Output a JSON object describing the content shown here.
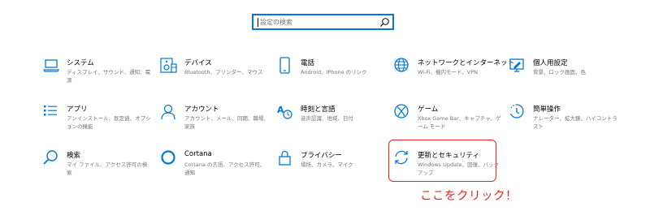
{
  "search": {
    "placeholder": "設定の検索"
  },
  "tiles": [
    {
      "title": "システム",
      "desc": "ディスプレイ、サウンド、通知、電源",
      "icon": "laptop-icon"
    },
    {
      "title": "デバイス",
      "desc": "Bluetooth、プリンター、マウス",
      "icon": "devices-icon"
    },
    {
      "title": "電話",
      "desc": "Android、iPhone のリンク",
      "icon": "phone-icon"
    },
    {
      "title": "ネットワークとインターネット",
      "desc": "Wi-Fi、機内モード、VPN",
      "icon": "globe-icon"
    },
    {
      "title": "個人用設定",
      "desc": "背景、ロック画面、色",
      "icon": "personalization-icon"
    },
    {
      "title": "アプリ",
      "desc": "アンインストール、既定値、オプションの機能",
      "icon": "apps-list-icon"
    },
    {
      "title": "アカウント",
      "desc": "アカウント、メール、同期、職場、家族",
      "icon": "person-icon"
    },
    {
      "title": "時刻と言語",
      "desc": "音声認識、地域、日付",
      "icon": "time-language-icon"
    },
    {
      "title": "ゲーム",
      "desc": "Xbox Game Bar、キャプチャ、ゲーム モード",
      "icon": "xbox-icon"
    },
    {
      "title": "簡単操作",
      "desc": "ナレーター、拡大鏡、ハイコントラスト",
      "icon": "ease-of-access-icon"
    },
    {
      "title": "検索",
      "desc": "マイ ファイル、アクセス許可の検索",
      "icon": "search-icon"
    },
    {
      "title": "Cortana",
      "desc": "Cortana の言語、アクセス許可、通知",
      "icon": "cortana-icon"
    },
    {
      "title": "プライバシー",
      "desc": "場所、カメラ、マイク",
      "icon": "lock-icon"
    },
    {
      "title": "更新とセキュリティ",
      "desc": "Windows Update、回復、バックアップ",
      "icon": "sync-icon"
    }
  ],
  "annotation": {
    "text": "ここをクリック！"
  },
  "colors": {
    "accent": "#0078d7",
    "annotation": "#e8262a",
    "description": "#767676"
  }
}
